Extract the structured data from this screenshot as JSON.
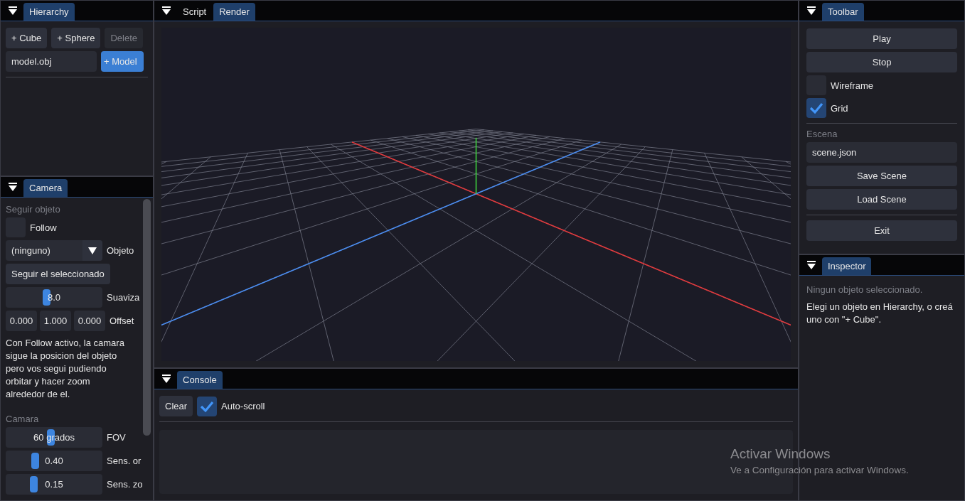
{
  "hierarchy": {
    "tabs": [
      {
        "label": "Hierarchy",
        "selected": true
      }
    ],
    "buttons": [
      {
        "label": "+ Cube",
        "disabled": false
      },
      {
        "label": "+ Sphere",
        "disabled": false
      },
      {
        "label": "Delete",
        "disabled": true
      }
    ],
    "model_field": {
      "value": "model.obj"
    },
    "model_button": {
      "label": "+ Model"
    }
  },
  "camera": {
    "tabs": [
      {
        "label": "Camera",
        "selected": true
      }
    ],
    "follow_section": "Seguir objeto",
    "follow": {
      "label": "Follow",
      "checked": false
    },
    "object_combo": {
      "value": "(ninguno)",
      "label": "Objeto"
    },
    "follow_selected_button": "Seguir el seleccionado",
    "smoothing": {
      "value": "8.0",
      "level": 0.4,
      "label": "Suaviza"
    },
    "offset": {
      "values": [
        "0.000",
        "1.000",
        "0.000"
      ],
      "label": "Offset"
    },
    "note": "Con Follow activo, la camara sigue la posicion del objeto pero vos segui pudiendo orbitar y hacer zoom alrededor de el.",
    "camera_section": "Camara",
    "sliders": [
      {
        "value": "60 grados",
        "level": 0.45,
        "label": "FOV"
      },
      {
        "value": "0.40",
        "level": 0.27,
        "label": "Sens. or"
      },
      {
        "value": "0.15",
        "level": 0.25,
        "label": "Sens. zo"
      }
    ]
  },
  "viewport": {
    "tabs": [
      {
        "label": "Script",
        "selected": false
      },
      {
        "label": "Render",
        "selected": true
      }
    ]
  },
  "console": {
    "tabs": [
      {
        "label": "Console",
        "selected": true
      }
    ],
    "clear_button": "Clear",
    "auto_scroll": {
      "label": "Auto-scroll",
      "checked": true
    }
  },
  "toolbar": {
    "tabs": [
      {
        "label": "Toolbar",
        "selected": true
      }
    ],
    "buttons": [
      "Play",
      "Stop"
    ],
    "checkboxes": [
      {
        "label": "Wireframe",
        "checked": false
      },
      {
        "label": "Grid",
        "checked": true
      }
    ],
    "scene_section": "Escena",
    "scene_field": {
      "value": "scene.json"
    },
    "scene_buttons": [
      "Save Scene",
      "Load Scene"
    ],
    "exit_button": "Exit"
  },
  "inspector": {
    "tabs": [
      {
        "label": "Inspector",
        "selected": true
      }
    ],
    "status": "Ningun objeto seleccionado.",
    "hint": "Elegi un objeto en Hierarchy, o creá uno con \"+ Cube\"."
  },
  "os_overlay": {
    "title": "Activar Windows",
    "subtitle": "Ve a Configuración para activar Windows."
  }
}
